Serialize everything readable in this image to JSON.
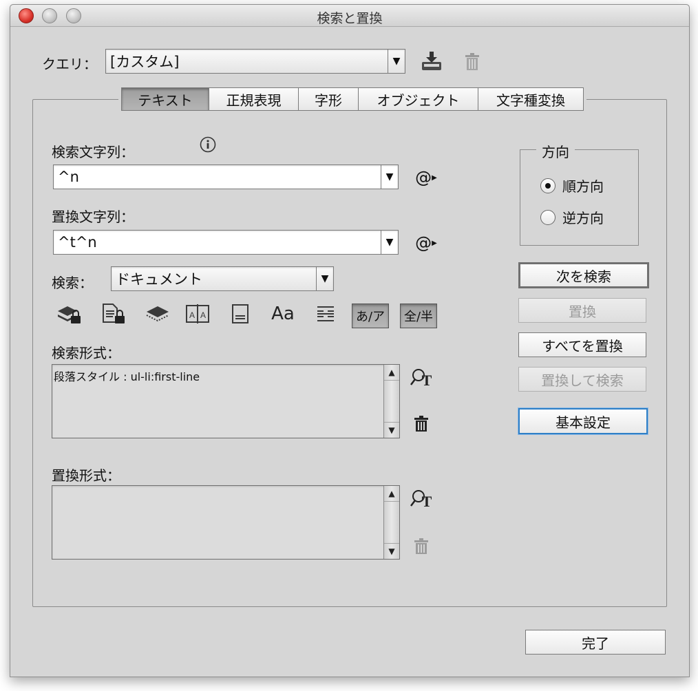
{
  "window": {
    "title": "検索と置換"
  },
  "query": {
    "label": "クエリ：",
    "value": "[カスタム]",
    "save_icon": "save-query-icon",
    "delete_icon": "trash-icon"
  },
  "tabs": [
    {
      "label": "テキスト",
      "active": true
    },
    {
      "label": "正規表現",
      "active": false
    },
    {
      "label": "字形",
      "active": false
    },
    {
      "label": "オブジェクト",
      "active": false
    },
    {
      "label": "文字種変換",
      "active": false
    }
  ],
  "find": {
    "label": "検索文字列：",
    "value": "^n",
    "info_icon": "info-icon",
    "special_icon": "@"
  },
  "replace": {
    "label": "置換文字列：",
    "value": "^t^n",
    "special_icon": "@"
  },
  "search_scope": {
    "label": "検索：",
    "value": "ドキュメント"
  },
  "options": {
    "icons": [
      "locked-layers-icon",
      "locked-stories-icon",
      "hidden-layers-icon",
      "master-pages-icon",
      "footnotes-icon",
      "case-sensitive-icon",
      "whole-word-icon"
    ],
    "aa": "Aa",
    "kana": "あ/ア",
    "width": "全/半"
  },
  "find_format": {
    "label": "検索形式：",
    "value": "段落スタイル : ul-li:first-line"
  },
  "replace_format": {
    "label": "置換形式：",
    "value": ""
  },
  "direction": {
    "label": "方向",
    "forward": "順方向",
    "backward": "逆方向",
    "selected": "forward"
  },
  "buttons": {
    "find_next": "次を検索",
    "replace": "置換",
    "replace_all": "すべてを置換",
    "replace_find": "置換して検索",
    "basic": "基本設定",
    "done": "完了"
  }
}
